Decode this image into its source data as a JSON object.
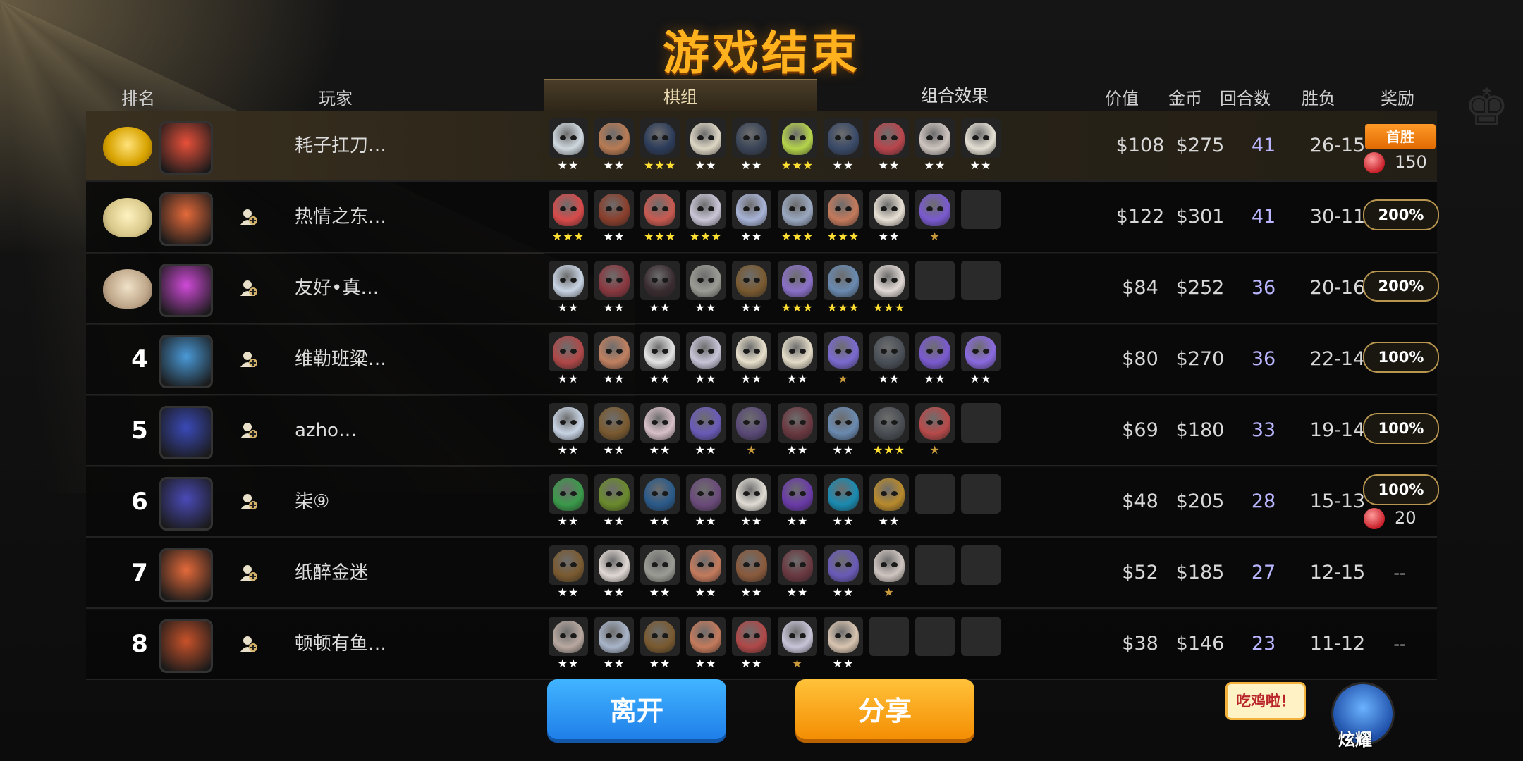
{
  "title": "游戏结束",
  "headers": {
    "rank": "排名",
    "player": "玩家",
    "lineup": "棋组",
    "synergy": "组合效果",
    "value": "价值",
    "gold": "金币",
    "rounds": "回合数",
    "record": "胜负",
    "reward": "奖励"
  },
  "active_tab": "棋组",
  "colors": {
    "title": "#ffb21e",
    "rounds": "#b9b6ff",
    "reward_border": "#b89650",
    "first_win": "#f38b00"
  },
  "players": [
    {
      "rank": "",
      "medal": "gold",
      "avatar_color": "#e8503a",
      "name": "耗子扛刀…",
      "friend": false,
      "value": "$108",
      "gold": "$275",
      "rounds": "41",
      "record": "26-15",
      "reward_badge": "首胜",
      "candy": "150",
      "units": [
        [
          "#cfd9e0",
          "2"
        ],
        [
          "#b87b54",
          "2"
        ],
        [
          "#2c3c5a",
          "3"
        ],
        [
          "#ddd6c4",
          "2"
        ],
        [
          "#3a4558",
          "2"
        ],
        [
          "#b5d44a",
          "3"
        ],
        [
          "#3a4a68",
          "2"
        ],
        [
          "#b8454c",
          "2"
        ],
        [
          "#cfc5c0",
          "2"
        ],
        [
          "#e4e0d4",
          "2"
        ]
      ]
    },
    {
      "rank": "",
      "medal": "silver",
      "avatar_color": "#e46a3a",
      "name": "热情之东…",
      "friend": true,
      "value": "$122",
      "gold": "$301",
      "rounds": "41",
      "record": "30-11",
      "reward_pct": "200%",
      "units": [
        [
          "#d84a4a",
          "3"
        ],
        [
          "#8a3f2c",
          "2"
        ],
        [
          "#c85a50",
          "3"
        ],
        [
          "#cac6d8",
          "3"
        ],
        [
          "#a8b4d8",
          "2"
        ],
        [
          "#9aa8c0",
          "3"
        ],
        [
          "#c47a5c",
          "3"
        ],
        [
          "#e8e0d4",
          "2"
        ],
        [
          "#7a5ad0",
          "1b"
        ],
        null
      ]
    },
    {
      "rank": "",
      "medal": "bronze",
      "avatar_color": "#d04ad8",
      "name": "友好•真…",
      "friend": true,
      "value": "$84",
      "gold": "$252",
      "rounds": "36",
      "record": "20-16",
      "reward_pct": "200%",
      "units": [
        [
          "#c8d4e4",
          "2"
        ],
        [
          "#8a3840",
          "2"
        ],
        [
          "#3a2c30",
          "2"
        ],
        [
          "#9a9c94",
          "2"
        ],
        [
          "#7a5a30",
          "2"
        ],
        [
          "#8a70c8",
          "3"
        ],
        [
          "#6a8ab0",
          "3"
        ],
        [
          "#e0d8d4",
          "3"
        ],
        null,
        null
      ]
    },
    {
      "rank": "4",
      "medal": "",
      "avatar_color": "#4a9ad8",
      "name": "维勒班粱…",
      "friend": true,
      "value": "$80",
      "gold": "$270",
      "rounds": "36",
      "record": "22-14",
      "reward_pct": "100%",
      "units": [
        [
          "#b04848",
          "2"
        ],
        [
          "#c08060",
          "2"
        ],
        [
          "#e4e4e4",
          "2"
        ],
        [
          "#c8c4d8",
          "2"
        ],
        [
          "#e8e0cc",
          "2"
        ],
        [
          "#e4dcc8",
          "2"
        ],
        [
          "#7a6ad0",
          "1b"
        ],
        [
          "#4a5058",
          "2"
        ],
        [
          "#7a5ad0",
          "2"
        ],
        [
          "#8a6ae0",
          "2"
        ]
      ]
    },
    {
      "rank": "5",
      "medal": "",
      "avatar_color": "#3a4ab8",
      "name": "azho…",
      "friend": true,
      "value": "$69",
      "gold": "$180",
      "rounds": "33",
      "record": "19-14",
      "reward_pct": "100%",
      "units": [
        [
          "#c8d4e4",
          "2"
        ],
        [
          "#7a5a30",
          "2"
        ],
        [
          "#d8c0c8",
          "2"
        ],
        [
          "#6a5ab8",
          "2"
        ],
        [
          "#5a4a78",
          "1b"
        ],
        [
          "#6a3840",
          "2"
        ],
        [
          "#6a8ab0",
          "2"
        ],
        [
          "#4a4e54",
          "3"
        ],
        [
          "#b84a4a",
          "1b"
        ],
        null
      ]
    },
    {
      "rank": "6",
      "medal": "",
      "avatar_color": "#4a4ab8",
      "name": "柒⑨",
      "friend": true,
      "value": "$48",
      "gold": "$205",
      "rounds": "28",
      "record": "15-13",
      "reward_pct": "100%",
      "candy": "20",
      "units": [
        [
          "#3a9a4a",
          "2"
        ],
        [
          "#6a8a2c",
          "2"
        ],
        [
          "#2a5a8a",
          "2"
        ],
        [
          "#6a4a7a",
          "2"
        ],
        [
          "#e0dcd4",
          "2"
        ],
        [
          "#6a3aa8",
          "2"
        ],
        [
          "#1a8ab0",
          "2"
        ],
        [
          "#b88a2c",
          "2"
        ],
        null,
        null
      ]
    },
    {
      "rank": "7",
      "medal": "",
      "avatar_color": "#e46a3a",
      "name": "纸醉金迷",
      "friend": true,
      "value": "$52",
      "gold": "$185",
      "rounds": "27",
      "record": "12-15",
      "reward_dash": "--",
      "units": [
        [
          "#7a5a30",
          "2"
        ],
        [
          "#e0d8d4",
          "2"
        ],
        [
          "#9a9c94",
          "2"
        ],
        [
          "#c47a5c",
          "2"
        ],
        [
          "#8a5a3c",
          "2"
        ],
        [
          "#6a3840",
          "2"
        ],
        [
          "#6a5ab8",
          "2"
        ],
        [
          "#cfc5c0",
          "1b"
        ],
        null,
        null
      ]
    },
    {
      "rank": "8",
      "medal": "",
      "avatar_color": "#c8522a",
      "name": "顿顿有鱼…",
      "friend": true,
      "value": "$38",
      "gold": "$146",
      "rounds": "23",
      "record": "11-12",
      "reward_dash": "--",
      "units": [
        [
          "#b8a8a0",
          "2"
        ],
        [
          "#a8b4c8",
          "2"
        ],
        [
          "#7a5a30",
          "2"
        ],
        [
          "#c47a5c",
          "2"
        ],
        [
          "#b04848",
          "2"
        ],
        [
          "#c8c4d8",
          "1b"
        ],
        [
          "#d8c4b0",
          "2"
        ],
        null,
        null,
        null
      ]
    }
  ],
  "buttons": {
    "leave": "离开",
    "share": "分享"
  },
  "brag": {
    "bubble": "吃鸡啦！",
    "label": "炫耀"
  }
}
